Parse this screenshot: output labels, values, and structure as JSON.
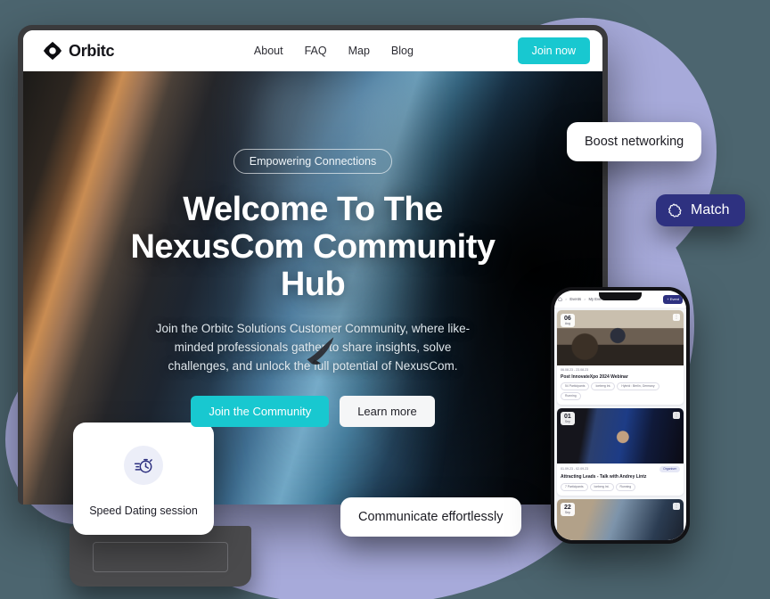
{
  "theme": {
    "page_background": "#4c656f",
    "blob_color": "#a7aada",
    "accent_teal": "#18c8d0",
    "accent_indigo": "#2e3180"
  },
  "laptop": {
    "nav": {
      "brand_name": "Orbitc",
      "brand_icon": "orbit-diamond-logo-icon",
      "links": [
        {
          "label": "About"
        },
        {
          "label": "FAQ"
        },
        {
          "label": "Map"
        },
        {
          "label": "Blog"
        }
      ],
      "cta_label": "Join now"
    },
    "hero": {
      "pill_label": "Empowering Connections",
      "title": "Welcome To The NexusCom Community Hub",
      "subtitle": "Join the Orbitc Solutions Customer Community, where like-minded professionals gather to share insights, solve challenges, and unlock the full potential of NexusCom.",
      "primary_cta": "Join the Community",
      "secondary_cta": "Learn more",
      "decoration_icon": "rocket-icon"
    }
  },
  "floating": {
    "boost_chip": {
      "label": "Boost networking"
    },
    "match_chip": {
      "label": "Match",
      "icon": "puzzle-piece-icon"
    },
    "communicate_chip": {
      "label": "Communicate effortlessly"
    },
    "feature_card": {
      "label": "Speed Dating session",
      "icon": "stopwatch-speed-icon"
    }
  },
  "phone": {
    "breadcrumb": {
      "home_icon": "home-icon",
      "items": [
        "Events",
        "My Events"
      ],
      "separator": ">"
    },
    "add_event_label": "+ Event",
    "events": [
      {
        "day": "06",
        "month": "Aug",
        "date_range": "06.08.23 - 23.08.23",
        "title": "Post InnovateXpo 2024 Webinar",
        "organiser_tag": "",
        "tags": [
          "54 Participants",
          "Iceberg Int.",
          "Hybrid : Berlin, Germany",
          "Running"
        ]
      },
      {
        "day": "01",
        "month": "Sep",
        "date_range": "01.09.23 - 02.09.23",
        "title": "Attracting Leads - Talk with Andrey Lintz",
        "organiser_tag": "Organiser",
        "tags": [
          "7 Participants",
          "Iceberg Int.",
          "Running"
        ]
      },
      {
        "day": "22",
        "month": "Sep",
        "date_range": "",
        "title": "",
        "organiser_tag": "",
        "tags": []
      }
    ]
  }
}
